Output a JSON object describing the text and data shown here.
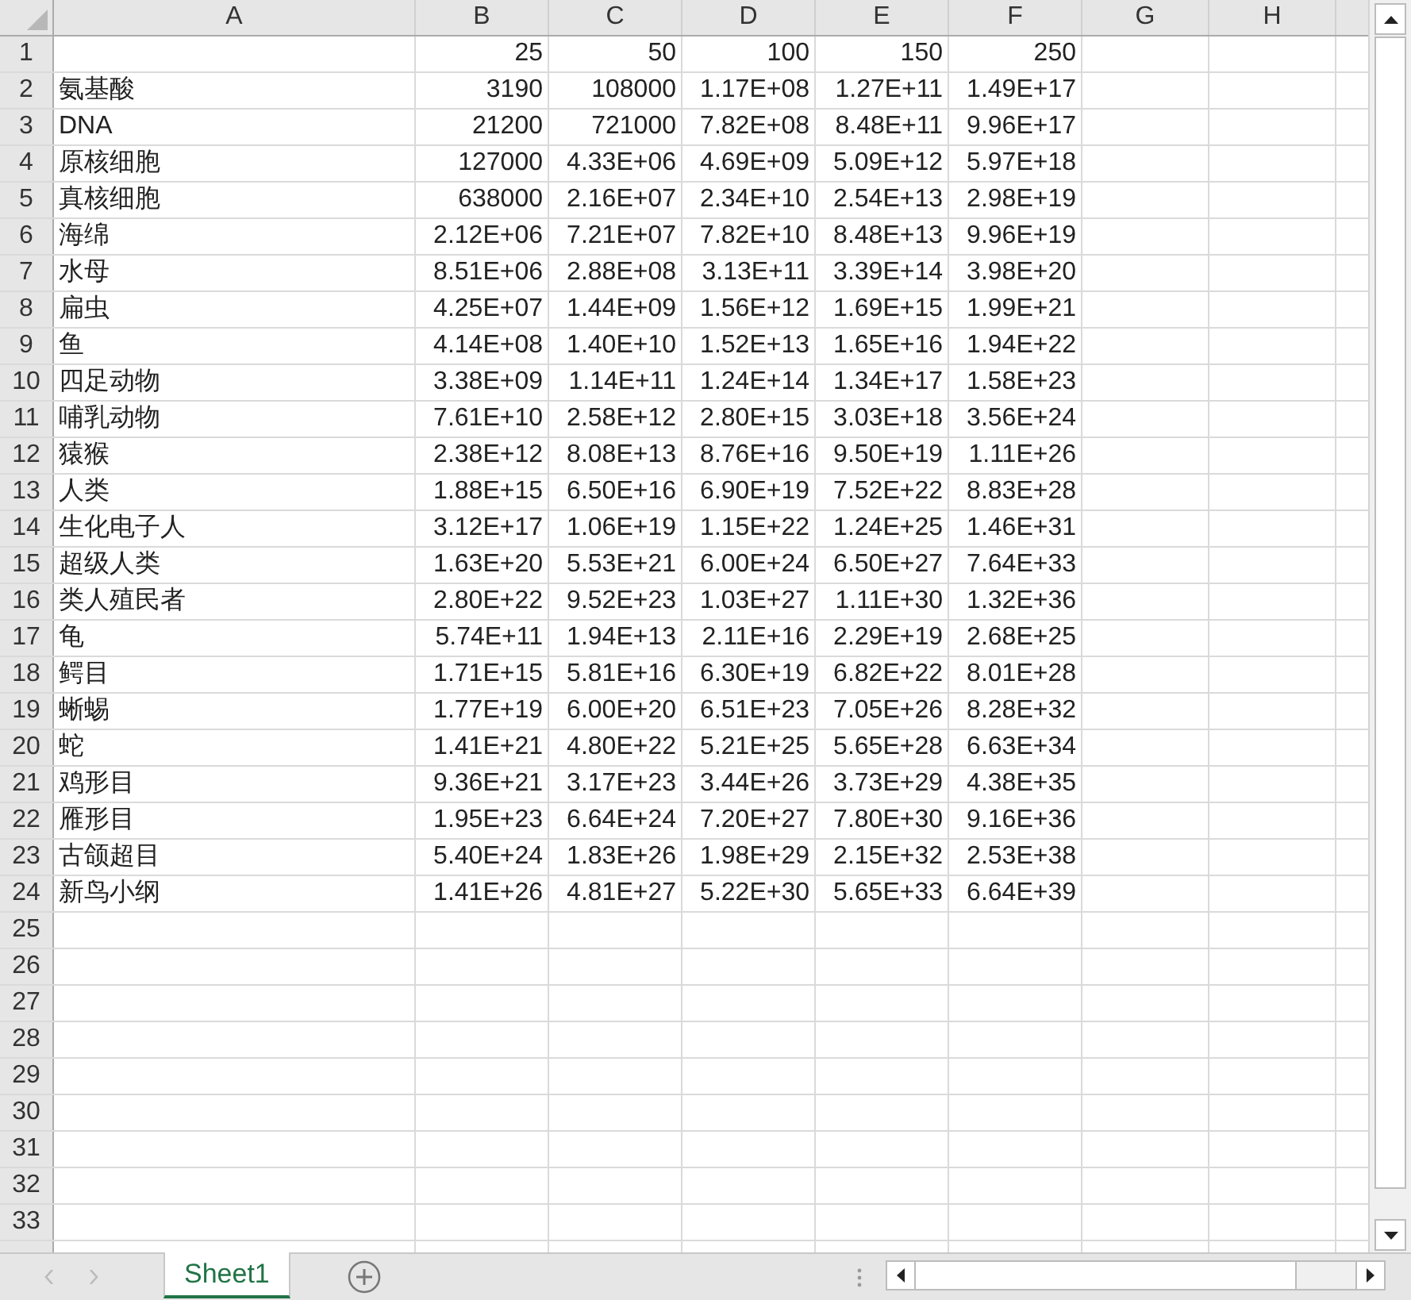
{
  "columns": [
    "A",
    "B",
    "C",
    "D",
    "E",
    "F",
    "G",
    "H"
  ],
  "rows": [
    {
      "number": "1",
      "values": [
        "25",
        "50",
        "100",
        "150",
        "250"
      ]
    },
    {
      "number": "2",
      "label": "氨基酸",
      "values": [
        "3190",
        "108000",
        "1.17E+08",
        "1.27E+11",
        "1.49E+17"
      ]
    },
    {
      "number": "3",
      "label": "DNA",
      "values": [
        "21200",
        "721000",
        "7.82E+08",
        "8.48E+11",
        "9.96E+17"
      ]
    },
    {
      "number": "4",
      "label": "原核细胞",
      "values": [
        "127000",
        "4.33E+06",
        "4.69E+09",
        "5.09E+12",
        "5.97E+18"
      ]
    },
    {
      "number": "5",
      "label": "真核细胞",
      "values": [
        "638000",
        "2.16E+07",
        "2.34E+10",
        "2.54E+13",
        "2.98E+19"
      ]
    },
    {
      "number": "6",
      "label": "海绵",
      "values": [
        "2.12E+06",
        "7.21E+07",
        "7.82E+10",
        "8.48E+13",
        "9.96E+19"
      ]
    },
    {
      "number": "7",
      "label": "水母",
      "values": [
        "8.51E+06",
        "2.88E+08",
        "3.13E+11",
        "3.39E+14",
        "3.98E+20"
      ]
    },
    {
      "number": "8",
      "label": "扁虫",
      "values": [
        "4.25E+07",
        "1.44E+09",
        "1.56E+12",
        "1.69E+15",
        "1.99E+21"
      ]
    },
    {
      "number": "9",
      "label": "鱼",
      "values": [
        "4.14E+08",
        "1.40E+10",
        "1.52E+13",
        "1.65E+16",
        "1.94E+22"
      ]
    },
    {
      "number": "10",
      "label": "四足动物",
      "values": [
        "3.38E+09",
        "1.14E+11",
        "1.24E+14",
        "1.34E+17",
        "1.58E+23"
      ]
    },
    {
      "number": "11",
      "label": "哺乳动物",
      "values": [
        "7.61E+10",
        "2.58E+12",
        "2.80E+15",
        "3.03E+18",
        "3.56E+24"
      ]
    },
    {
      "number": "12",
      "label": "猿猴",
      "values": [
        "2.38E+12",
        "8.08E+13",
        "8.76E+16",
        "9.50E+19",
        "1.11E+26"
      ]
    },
    {
      "number": "13",
      "label": "人类",
      "values": [
        "1.88E+15",
        "6.50E+16",
        "6.90E+19",
        "7.52E+22",
        "8.83E+28"
      ]
    },
    {
      "number": "14",
      "label": "生化电子人",
      "values": [
        "3.12E+17",
        "1.06E+19",
        "1.15E+22",
        "1.24E+25",
        "1.46E+31"
      ]
    },
    {
      "number": "15",
      "label": "超级人类",
      "values": [
        "1.63E+20",
        "5.53E+21",
        "6.00E+24",
        "6.50E+27",
        "7.64E+33"
      ]
    },
    {
      "number": "16",
      "label": "类人殖民者",
      "values": [
        "2.80E+22",
        "9.52E+23",
        "1.03E+27",
        "1.11E+30",
        "1.32E+36"
      ]
    },
    {
      "number": "17",
      "label": "龟",
      "values": [
        "5.74E+11",
        "1.94E+13",
        "2.11E+16",
        "2.29E+19",
        "2.68E+25"
      ]
    },
    {
      "number": "18",
      "label": "鳄目",
      "values": [
        "1.71E+15",
        "5.81E+16",
        "6.30E+19",
        "6.82E+22",
        "8.01E+28"
      ]
    },
    {
      "number": "19",
      "label": "蜥蜴",
      "values": [
        "1.77E+19",
        "6.00E+20",
        "6.51E+23",
        "7.05E+26",
        "8.28E+32"
      ]
    },
    {
      "number": "20",
      "label": "蛇",
      "values": [
        "1.41E+21",
        "4.80E+22",
        "5.21E+25",
        "5.65E+28",
        "6.63E+34"
      ]
    },
    {
      "number": "21",
      "label": "鸡形目",
      "values": [
        "9.36E+21",
        "3.17E+23",
        "3.44E+26",
        "3.73E+29",
        "4.38E+35"
      ]
    },
    {
      "number": "22",
      "label": "雁形目",
      "values": [
        "1.95E+23",
        "6.64E+24",
        "7.20E+27",
        "7.80E+30",
        "9.16E+36"
      ]
    },
    {
      "number": "23",
      "label": "古颌超目",
      "values": [
        "5.40E+24",
        "1.83E+26",
        "1.98E+29",
        "2.15E+32",
        "2.53E+38"
      ]
    },
    {
      "number": "24",
      "label": "新鸟小纲",
      "values": [
        "1.41E+26",
        "4.81E+27",
        "5.22E+30",
        "5.65E+33",
        "6.64E+39"
      ]
    },
    {
      "number": "25"
    },
    {
      "number": "26"
    },
    {
      "number": "27"
    },
    {
      "number": "28"
    },
    {
      "number": "29"
    },
    {
      "number": "30"
    },
    {
      "number": "31"
    },
    {
      "number": "32"
    },
    {
      "number": "33"
    }
  ],
  "sheet_tabs": [
    {
      "label": "Sheet1",
      "selected": true
    }
  ]
}
